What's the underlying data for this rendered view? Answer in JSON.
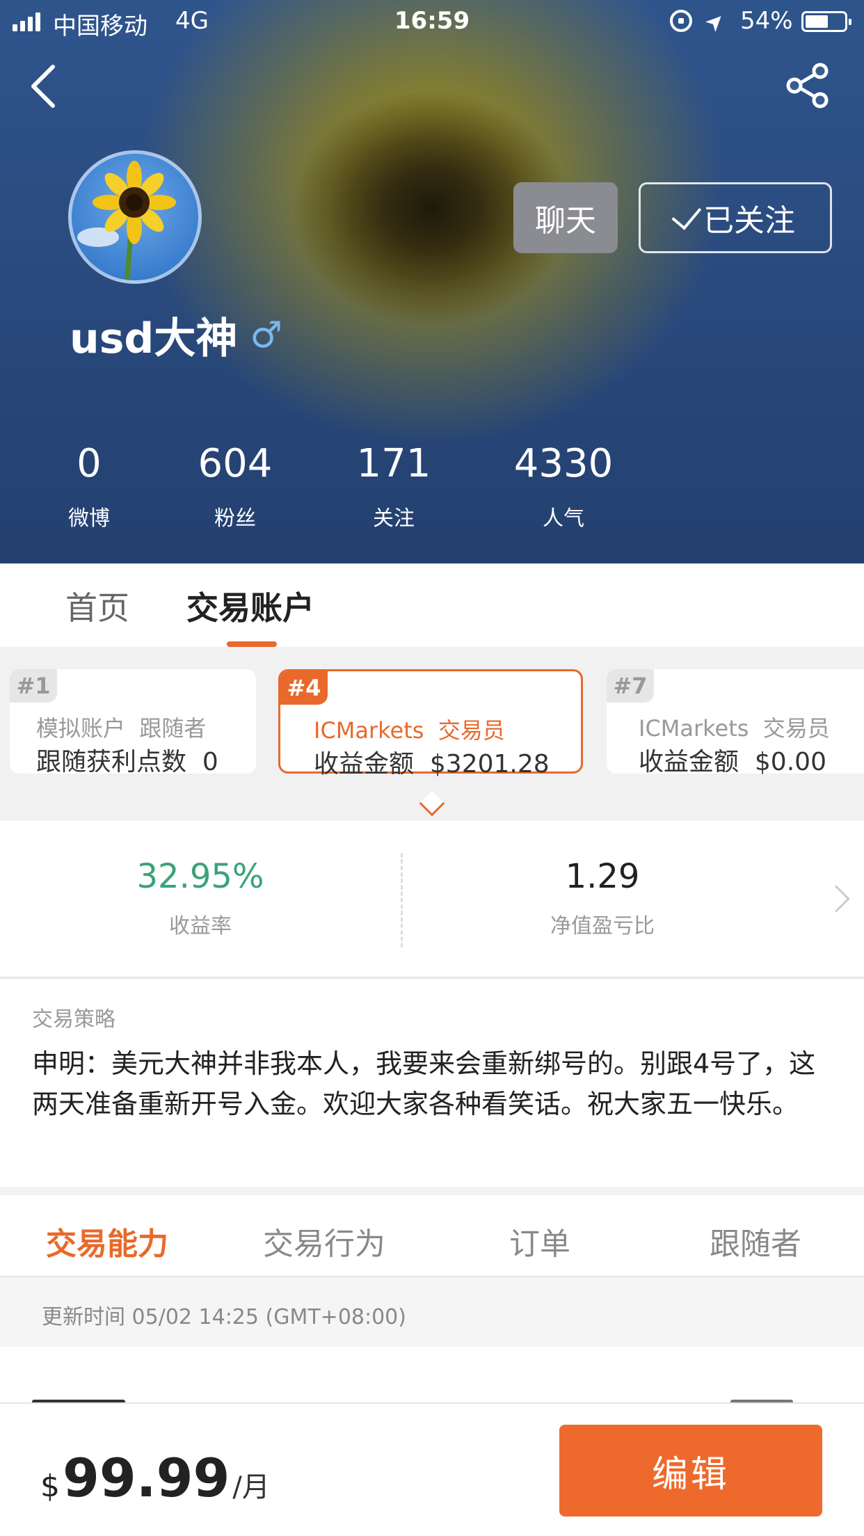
{
  "status_bar": {
    "carrier": "中国移动",
    "network": "4G",
    "time": "16:59",
    "battery": "54%"
  },
  "profile": {
    "username": "usd大神",
    "gender_symbol": "♂",
    "chat_label": "聊天",
    "follow_label": "已关注",
    "stats": [
      {
        "value": "0",
        "label": "微博"
      },
      {
        "value": "604",
        "label": "粉丝"
      },
      {
        "value": "171",
        "label": "关注"
      },
      {
        "value": "4330",
        "label": "人气"
      }
    ]
  },
  "profile_tabs": [
    {
      "label": "首页",
      "active": false
    },
    {
      "label": "交易账户",
      "active": true
    }
  ],
  "accounts": [
    {
      "rank": "#1",
      "broker": "模拟账户",
      "role": "跟随者",
      "metric_label": "跟随获利点数",
      "metric_value": "0",
      "selected": false
    },
    {
      "rank": "#4",
      "broker": "ICMarkets",
      "role": "交易员",
      "metric_label": "收益金额",
      "metric_value": "$3201.28",
      "selected": true
    },
    {
      "rank": "#7",
      "broker": "ICMarkets",
      "role": "交易员",
      "metric_label": "收益金额",
      "metric_value": "$0.00",
      "selected": false
    }
  ],
  "metrics": {
    "return_rate": {
      "value": "32.95%",
      "label": "收益率",
      "color": "#3aa37a"
    },
    "equity_ratio": {
      "value": "1.29",
      "label": "净值盈亏比"
    }
  },
  "strategy": {
    "title": "交易策略",
    "text": "申明：美元大神并非我本人，我要来会重新绑号的。别跟4号了，这两天准备重新开号入金。欢迎大家各种看笑话。祝大家五一快乐。"
  },
  "analysis_tabs": [
    {
      "label": "交易能力",
      "active": true
    },
    {
      "label": "交易行为",
      "active": false
    },
    {
      "label": "订单",
      "active": false
    },
    {
      "label": "跟随者",
      "active": false
    }
  ],
  "update_time": "更新时间 05/02 14:25 (GMT+08:00)",
  "subscription": {
    "currency": "$",
    "amount": "99.99",
    "period": "/月",
    "edit_label": "编辑"
  },
  "colors": {
    "accent": "#e8692b",
    "positive": "#3aa37a"
  }
}
